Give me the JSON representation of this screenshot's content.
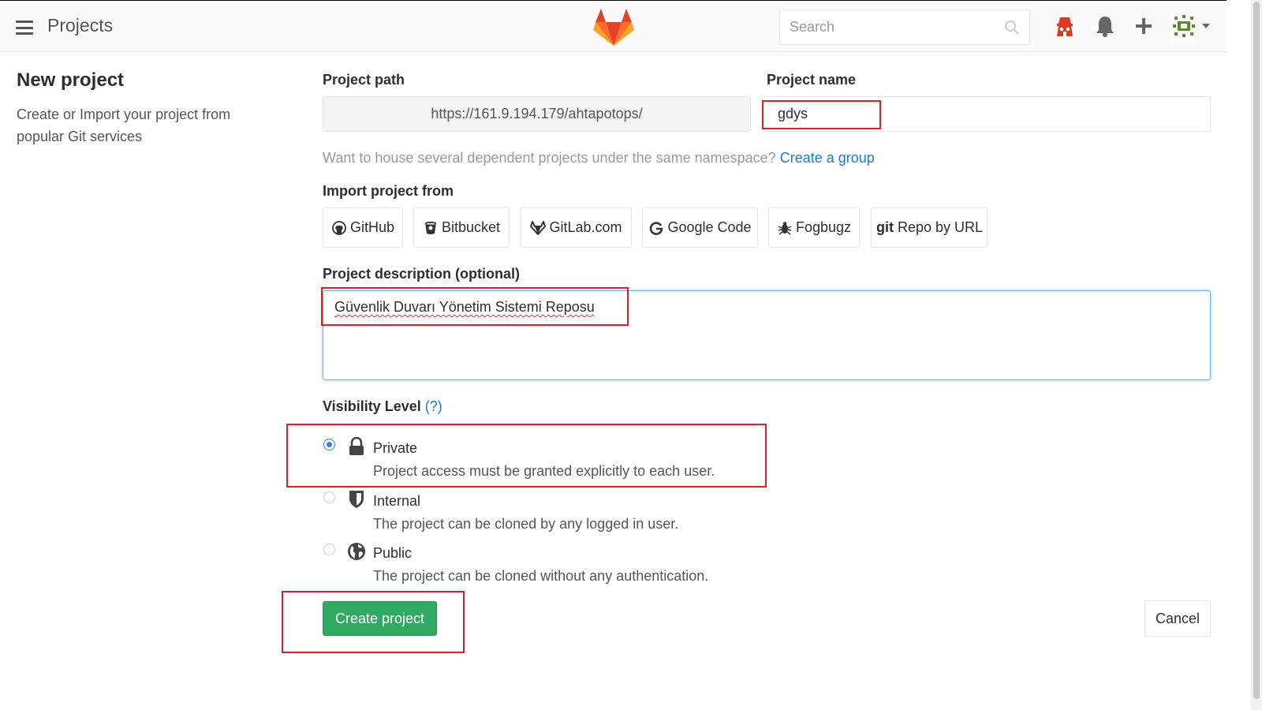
{
  "header": {
    "title": "Projects",
    "search_placeholder": "Search"
  },
  "page": {
    "title": "New project",
    "description": "Create or Import your project from popular Git services"
  },
  "form": {
    "project_path_label": "Project path",
    "project_path_value": "https://161.9.194.179/ahtapotops/",
    "project_name_label": "Project name",
    "project_name_value": "gdys",
    "group_hint": "Want to house several dependent projects under the same namespace?",
    "group_link": "Create a group",
    "import_label": "Import project from",
    "import_sources": [
      {
        "label": "GitHub",
        "icon": "github-icon"
      },
      {
        "label": "Bitbucket",
        "icon": "bitbucket-icon"
      },
      {
        "label": "GitLab.com",
        "icon": "gitlab-icon"
      },
      {
        "label": "Google Code",
        "icon": "google-icon"
      },
      {
        "label": "Fogbugz",
        "icon": "bug-icon"
      },
      {
        "label": "Repo by URL",
        "icon": "git-icon"
      }
    ],
    "description_label": "Project description (optional)",
    "description_value": "Güvenlik Duvarı Yönetim Sistemi Reposu",
    "visibility_label": "Visibility Level",
    "visibility_help": "(?)",
    "visibility_options": [
      {
        "title": "Private",
        "description": "Project access must be granted explicitly to each user.",
        "icon": "lock-icon",
        "selected": true
      },
      {
        "title": "Internal",
        "description": "The project can be cloned by any logged in user.",
        "icon": "shield-icon",
        "selected": false
      },
      {
        "title": "Public",
        "description": "The project can be cloned without any authentication.",
        "icon": "globe-icon",
        "selected": false
      }
    ],
    "create_button": "Create project",
    "cancel_button": "Cancel"
  },
  "colors": {
    "primary_blue": "#1f78d1",
    "create_green": "#2faa60",
    "annotation_red": "#e02020",
    "gitlab_orange": "#fc6d26"
  }
}
